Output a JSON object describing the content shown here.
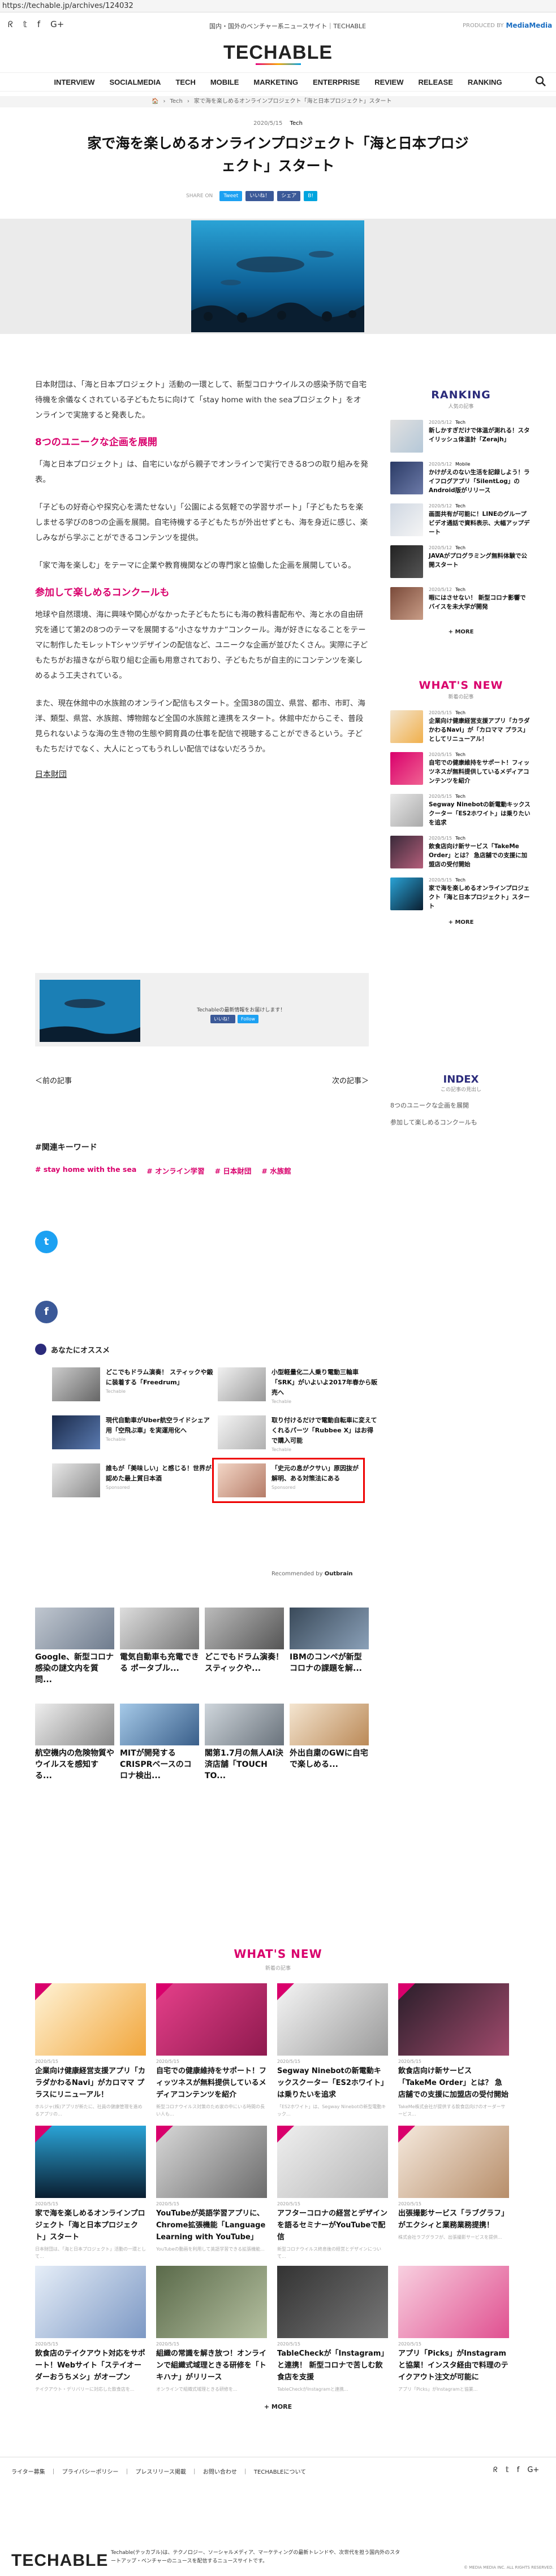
{
  "url": "https://techable.jp/archives/124032",
  "header": {
    "tagline": "国内・国外のベンチャー系ニュースサイト｜TECHABLE",
    "produced_by": "PRODUCED BY",
    "produced_brand": "MediaMedia",
    "logo": "TECHABLE",
    "nav": [
      "INTERVIEW",
      "SOCIALMEDIA",
      "TECH",
      "MOBILE",
      "MARKETING",
      "ENTERPRISE",
      "REVIEW",
      "RELEASE",
      "RANKING"
    ]
  },
  "breadcrumb": [
    "🏠",
    "Tech",
    "家で海を楽しめるオンラインプロジェクト「海と日本プロジェクト」スタート"
  ],
  "article": {
    "date": "2020/5/15",
    "category": "Tech",
    "title": "家で海を楽しめるオンラインプロジェクト「海と日本プロジェクト」スタート",
    "share_label": "SHARE ON",
    "share_buttons": [
      "Tweet",
      "いいね！",
      "シェア",
      "B!"
    ],
    "p1": "日本財団は、「海と日本プロジェクト」活動の一環として、新型コロナウイルスの感染予防で自宅待機を余儀なくされている子どもたちに向けて「stay home with the seaプロジェクト」をオンラインで実施すると発表した。",
    "h1": "8つのユニークな企画を展開",
    "p2": "「海と日本プロジェクト」は、自宅にいながら親子でオンラインで実行できる8つの取り組みを発表。",
    "p3": "「子どもの好奇心や探究心を満たせない」「公園による気軽での学習サポート」「子どもたちを楽しませる学びの8つの企画を展開。自宅待機する子どもたちが外出せずとも、海を身近に感じ、楽しみながら学ぶことができるコンテンツを提供。",
    "p4": "「家で海を楽しむ」をテーマに企業や教育機関などの専門家と協働した企画を展開している。",
    "h2": "参加して楽しめるコンクールも",
    "p5": "地球や自然環境、海に興味や関心がなかった子どもたちにも海の教科書配布や、海と水の自由研究を通じて第2の8つのテーマを展開する“小さなサカナ”コンクール。海が好きになることをテーマに制作したモレットTシャツデザインの配信など、ユニークな企画が並びたくさん。実際に子どもたちがお描きながら取り組む企画も用意されており、子どもたちが自主的にコンテンツを楽しめるよう工夫されている。",
    "p6": "また、現在休館中の水族館のオンライン配信もスタート。全国38の国立、県営、都市、市町、海洋、類型、県営、水族館、博物館など全国の水族館と連携をスタート。休館中だからこそ、普段見られないような海の生き物の生態や飼育員の仕事を配信で視聴することができるという。子どもたちだけでなく、大人にとってもうれしい配信ではないだろうか。",
    "source": "日本財団"
  },
  "sharebox": {
    "text": "Techableの最新情報をお届けします！",
    "buttons": [
      "いいね！",
      "Follow"
    ]
  },
  "pager": {
    "prev": "＜前の記事",
    "next": "次の記事＞"
  },
  "index": {
    "title": "INDEX",
    "sub": "この記事の見出し",
    "items": [
      "8つのユニークな企画を展開",
      "参加して楽しめるコンクールも"
    ]
  },
  "keywords": {
    "title": "#関連キーワード",
    "items": [
      "# stay home with the sea",
      "# オンライン学習",
      "# 日本財団",
      "# 水族館"
    ]
  },
  "ranking": {
    "title": "RANKING",
    "sub": "人気の記事",
    "items": [
      {
        "date": "2020/5/12",
        "cat": "Tech",
        "title": "新しかすぎだけで体温が測れる！スタイリッシュ体温計「Zerajh」"
      },
      {
        "date": "2020/5/12",
        "cat": "Mobile",
        "title": "かけがえのない生活を記録しよう！ライフログアプリ「SilentLog」のAndroid版がリリース"
      },
      {
        "date": "2020/5/12",
        "cat": "Tech",
        "title": "画面共有が可能に！LINEのグループビデオ通話で資料表示、大幅アップデート"
      },
      {
        "date": "2020/5/12",
        "cat": "Tech",
        "title": "JAVAがプログラミング無料体験で公開スタート"
      },
      {
        "date": "2020/5/12",
        "cat": "Tech",
        "title": "暇にはさせない！ 新型コロナ影響でバイスを未大学が開発"
      }
    ],
    "more": "+ MORE"
  },
  "whatsnew_side": {
    "title": "WHAT'S NEW",
    "sub": "新着の記事",
    "items": [
      {
        "date": "2020/5/15",
        "cat": "Tech",
        "title": "企業向け健康経営支援アプリ「カラダかわるNavi」が「カロママ プラス」としてリニューアル！"
      },
      {
        "date": "2020/5/15",
        "cat": "Tech",
        "title": "自宅での健康維持をサポート！フィッツネスが無料提供しているメディアコンテンツを紹介"
      },
      {
        "date": "2020/5/15",
        "cat": "Tech",
        "title": "Segway Ninebotの新電動キックスクーター「ES2ホワイト」は乗りたいを追求"
      },
      {
        "date": "2020/5/15",
        "cat": "Tech",
        "title": "飲食店向け新サービス「TakeMe Order」とは？ 急店舗での支援に加盟店の受付開始"
      },
      {
        "date": "2020/5/15",
        "cat": "Tech",
        "title": "家で海を楽しめるオンラインプロジェクト「海と日本プロジェクト」スタート"
      }
    ],
    "more": "+ MORE"
  },
  "recommend": {
    "title": "あなたにオススメ",
    "items": [
      {
        "title": "どこでもドラム演奏！ スティックや鍛に装着する「Freedrum」",
        "src": "Techable"
      },
      {
        "title": "小型軽量化二人乗り電動三輪車「SRK」がいよいよ2017年春から販売へ",
        "src": "Techable"
      },
      {
        "title": "現代自動車がUber航空ライドシェア用「空飛ぶ車」を実運用化へ",
        "src": "Techable"
      },
      {
        "title": "取り付けるだけで電動自転車に変えてくれるパーツ「Rubbee X」はお得で購入可能",
        "src": "Techable"
      },
      {
        "title": "誰もが「美味しい」と感じる！世界が認めた最上質日本酒",
        "src": "Sponsored"
      },
      {
        "title": "「史元の息がクサい」原因抜が解明、ある対策法にある",
        "src": "Sponsored"
      }
    ],
    "outbrain_label": "Recommended by",
    "outbrain_brand": "Outbrain"
  },
  "grid": [
    {
      "title": "Google、新型コロナ感染の謎文内を質問..."
    },
    {
      "title": "電気自動車も充電できる ポータブル..."
    },
    {
      "title": "どこでもドラム演奏！ スティックや..."
    },
    {
      "title": "IBMのコンペが新型コロナの課題を解..."
    },
    {
      "title": "航空機内の危険物質やウイルスを感知する..."
    },
    {
      "title": "MITが開発するCRISPRベースのコロナ検出..."
    },
    {
      "title": "閣第1.7月の無人AI決済店舗「TOUCH TO..."
    },
    {
      "title": "外出自粛のGWに自宅で楽しめる..."
    }
  ],
  "whatsnew": {
    "title": "WHAT'S NEW",
    "sub": "新着の記事",
    "items": [
      {
        "date": "2020/5/15",
        "title": "企業向け健康経営支援アプリ「カラダかわるNavi」がカロママ プラスにリニューアル！",
        "excerpt": "ホルジャ(株)アプリが新たに、社員の健康管理を進めるアプリの..."
      },
      {
        "date": "2020/5/15",
        "title": "自宅での健康維持をサポート！フィッツネスが無料提供しているメディアコンテンツを紹介",
        "excerpt": "新型コロナウイルス対策のため家の中にいる時間の長い人も..."
      },
      {
        "date": "2020/5/15",
        "title": "Segway Ninebotの新電動キックスクーター「ES2ホワイト」は乗りたいを追求",
        "excerpt": "「ES2ホワイト」は、Segway Ninebotの新型電動キック..."
      },
      {
        "date": "2020/5/15",
        "title": "飲食店向け新サービス「TakeMe Order」とは？ 急店舗での支援に加盟店の受付開始",
        "excerpt": "TakeMe株式会社が提供する飲食店向けのオーダーサービス..."
      },
      {
        "date": "2020/5/15",
        "title": "家で海を楽しめるオンラインプロジェクト「海と日本プロジェクト」スタート",
        "excerpt": "日本財団は、「海と日本プロジェクト」活動の一環として..."
      },
      {
        "date": "2020/5/15",
        "title": "YouTubeが英語学習アプリに、Chrome拡張機能「Language Learning with YouTube」",
        "excerpt": "YouTubeの動画を利用して英語学習できる拡張機能..."
      },
      {
        "date": "2020/5/15",
        "title": "アフターコロナの経営とデザインを語るセミナーがYouTubeで配信",
        "excerpt": "新型コロナウイルス終息後の経営とデザインについて..."
      },
      {
        "date": "2020/5/15",
        "title": "出張撮影サービス「ラブグラフ」がエクシィと業務業務提携！",
        "excerpt": "株式会社ラブグラフが、出張撮影サービスを提供..."
      },
      {
        "date": "2020/5/15",
        "title": "飲食店のテイクアウト対応をサポート！Webサイト「ステイオーダーおうちメシ」がオープン",
        "excerpt": "テイクアウト・デリバリーに対応した飲食店を..."
      },
      {
        "date": "2020/5/15",
        "title": "組織の常識を解き放つ！オンラインで組織式域理ときる研修を「トキハナ」がリリース",
        "excerpt": "オンラインで組織式域理ときる研修を..."
      },
      {
        "date": "2020/5/15",
        "title": "TableCheckが「Instagram」と連携！ 新型コロナで苦しむ飲食店を支援",
        "excerpt": "TableCheckがInstagramと連携..."
      },
      {
        "date": "2020/5/15",
        "title": "アプリ「Picks」がInstagramと協業！インスタ経由で料理のテイクアウト注文が可能に",
        "excerpt": "アプリ「Picks」がInstagramと協業..."
      }
    ],
    "more": "+ MORE"
  },
  "footer": {
    "links": [
      "ライター募集",
      "｜",
      "プライバシーポリシー",
      "｜",
      "プレスリリース掲載",
      "｜",
      "お問い合わせ",
      "｜",
      "TECHABLEについて"
    ],
    "logo": "TECHABLE",
    "desc": "Techable(テッカブル)は、テクノロジー、ソーシャルメディア、マーケティングの最新トレンドや、次世代を担う国内外のスタートアップ・ベンチャーのニュースを配信するニュースサイトです。",
    "copy": "© MEDIA MEDIA INC. ALL RIGHTS RESERVED."
  }
}
